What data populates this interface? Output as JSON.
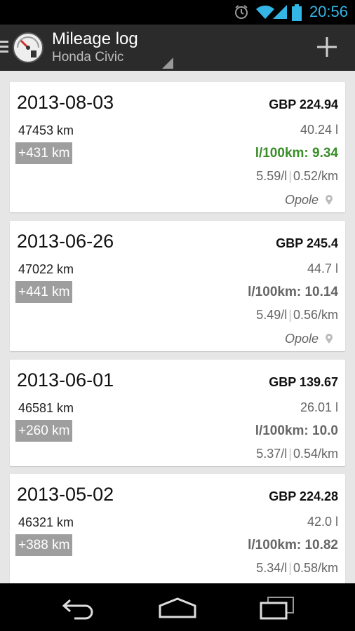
{
  "status": {
    "time": "20:56"
  },
  "header": {
    "title": "Mileage log",
    "subtitle": "Honda Civic"
  },
  "entries": [
    {
      "date": "2013-08-03",
      "price": "GBP 224.94",
      "odometer": "47453 km",
      "liters": "40.24 l",
      "delta": "+431 km",
      "consumption": "l/100km: 9.34",
      "consumption_good": true,
      "price_per_l": "5.59/l",
      "price_per_km": "0.52/km",
      "place": "Opole"
    },
    {
      "date": "2013-06-26",
      "price": "GBP 245.4",
      "odometer": "47022 km",
      "liters": "44.7 l",
      "delta": "+441 km",
      "consumption": "l/100km: 10.14",
      "consumption_good": false,
      "price_per_l": "5.49/l",
      "price_per_km": "0.56/km",
      "place": "Opole"
    },
    {
      "date": "2013-06-01",
      "price": "GBP 139.67",
      "odometer": "46581 km",
      "liters": "26.01 l",
      "delta": "+260 km",
      "consumption": "l/100km: 10.0",
      "consumption_good": false,
      "price_per_l": "5.37/l",
      "price_per_km": "0.54/km",
      "place": ""
    },
    {
      "date": "2013-05-02",
      "price": "GBP 224.28",
      "odometer": "46321 km",
      "liters": "42.0 l",
      "delta": "+388 km",
      "consumption": "l/100km: 10.82",
      "consumption_good": false,
      "price_per_l": "5.34/l",
      "price_per_km": "0.58/km",
      "place": ""
    }
  ],
  "colors": {
    "accent": "#33b5e5",
    "good": "#3a8e2a",
    "badge": "#9e9e9e"
  }
}
